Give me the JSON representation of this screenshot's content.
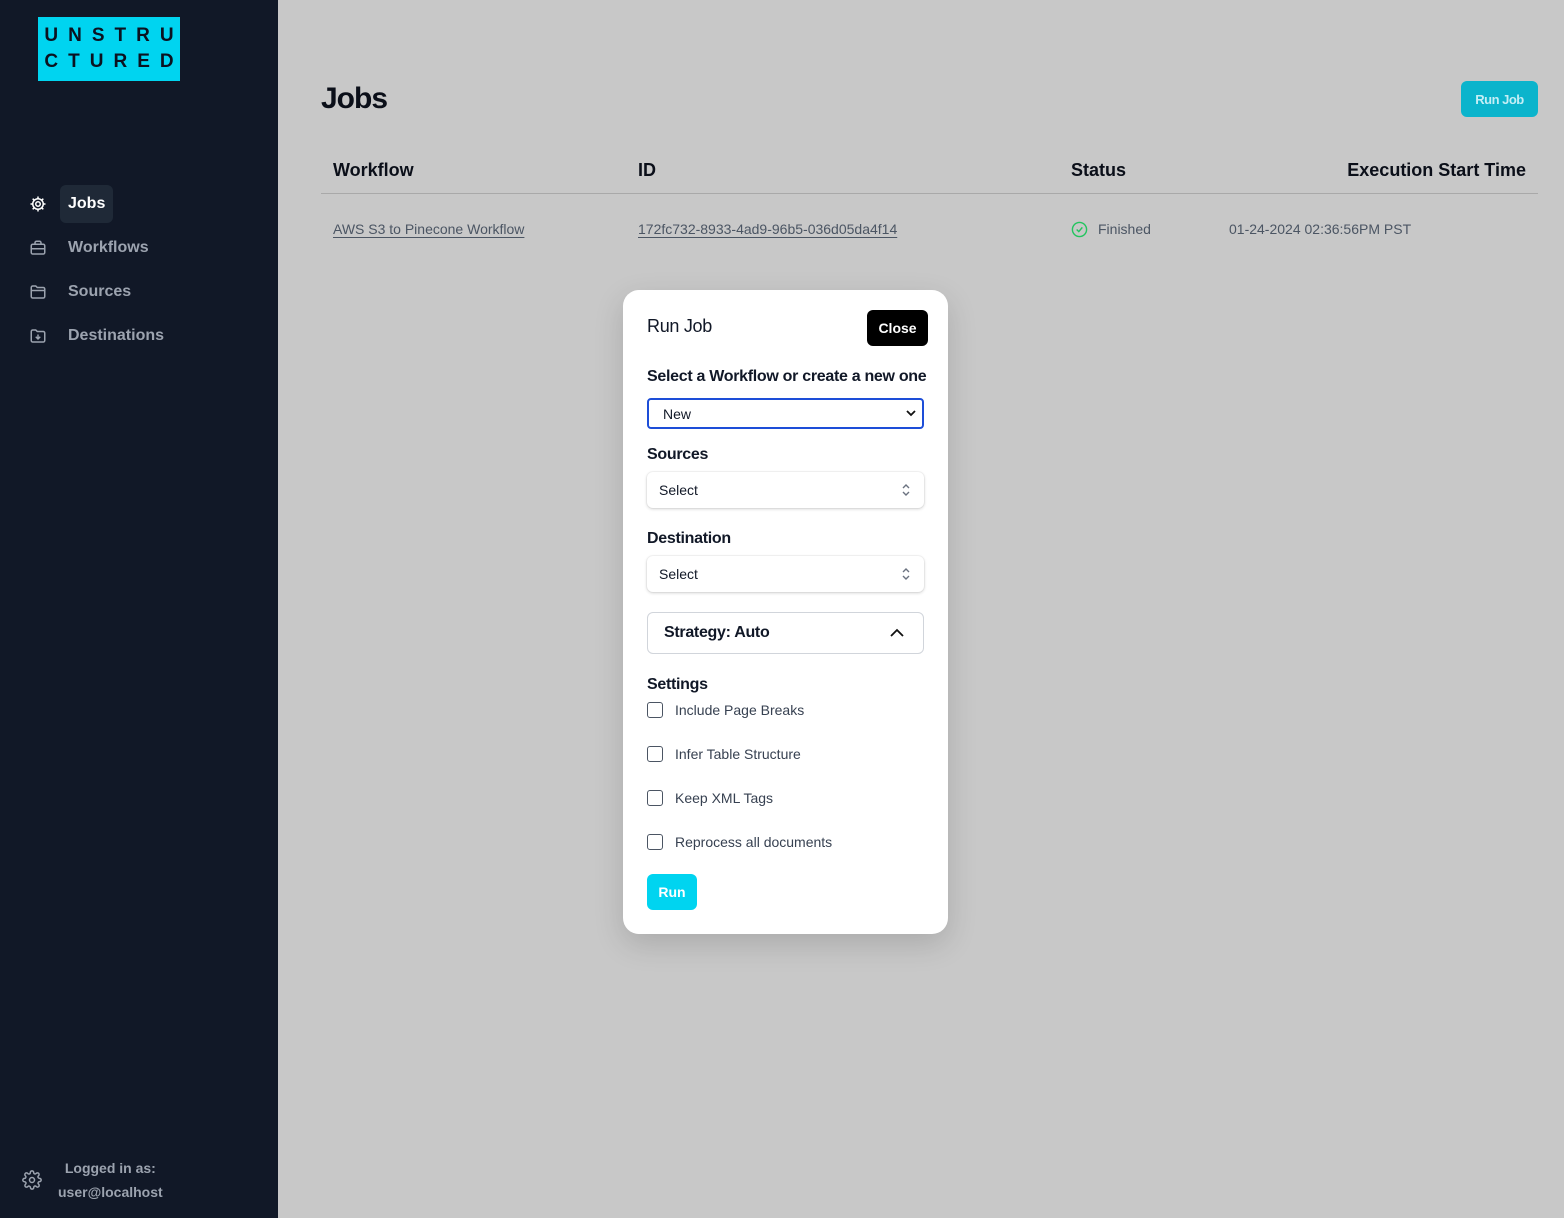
{
  "brand": {
    "logo_line1": "UNSTRU",
    "logo_line2": "CTURED",
    "accent": "#00d4f0"
  },
  "sidebar": {
    "items": [
      {
        "label": "Jobs",
        "icon": "gear-icon",
        "active": true
      },
      {
        "label": "Workflows",
        "icon": "briefcase-icon"
      },
      {
        "label": "Sources",
        "icon": "folder-icon"
      },
      {
        "label": "Destinations",
        "icon": "folder-download-icon"
      }
    ],
    "footer": {
      "logged_in_label": "Logged in as:",
      "user": "user@localhost"
    }
  },
  "main": {
    "title": "Jobs",
    "run_job_label": "Run Job",
    "table": {
      "headers": [
        "Workflow",
        "ID",
        "Status",
        "Execution Start Time"
      ],
      "rows": [
        {
          "workflow": "AWS S3 to Pinecone Workflow",
          "id": "172fc732-8933-4ad9-96b5-036d05da4f14",
          "status": "Finished",
          "time": "01-24-2024 02:36:56PM PST"
        }
      ]
    }
  },
  "modal": {
    "title": "Run Job",
    "close_label": "Close",
    "workflow_label": "Select a Workflow or create a new one",
    "workflow_value": "New",
    "sources_label": "Sources",
    "sources_value": "Select",
    "destination_label": "Destination",
    "destination_value": "Select",
    "strategy_label": "Strategy: Auto",
    "settings_label": "Settings",
    "settings": [
      {
        "label": "Include Page Breaks",
        "checked": false
      },
      {
        "label": "Infer Table Structure",
        "checked": false
      },
      {
        "label": "Keep XML Tags",
        "checked": false
      },
      {
        "label": "Reprocess all documents",
        "checked": false
      }
    ],
    "run_label": "Run"
  }
}
